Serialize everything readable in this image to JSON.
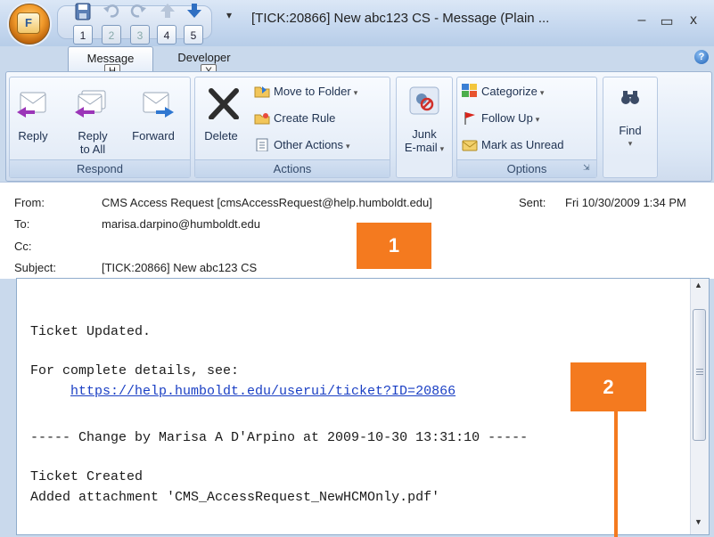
{
  "window": {
    "title": "[TICK:20866] New abc123 CS - Message (Plain ...",
    "office_button_letter": "F",
    "qat_keytips": [
      "1",
      "2",
      "3",
      "4",
      "5"
    ],
    "minimize": "–",
    "maximize": "▭",
    "close": "x"
  },
  "tabs": [
    {
      "label": "Message",
      "keytip": "H",
      "active": true
    },
    {
      "label": "Developer",
      "keytip": "Y",
      "active": false
    }
  ],
  "ribbon": {
    "respond": {
      "label": "Respond",
      "reply": "Reply",
      "reply_all_1": "Reply",
      "reply_all_2": "to All",
      "forward": "Forward"
    },
    "actions": {
      "label": "Actions",
      "delete": "Delete",
      "move_to_folder": "Move to Folder",
      "create_rule": "Create Rule",
      "other_actions": "Other Actions"
    },
    "junk": {
      "label_1": "Junk",
      "label_2": "E-mail"
    },
    "options": {
      "label": "Options",
      "categorize": "Categorize",
      "follow_up": "Follow Up",
      "mark_as_unread": "Mark as Unread"
    },
    "find": {
      "label": "Find"
    }
  },
  "header": {
    "from_label": "From:",
    "from_value": "CMS Access Request [cmsAccessRequest@help.humboldt.edu]",
    "sent_label": "Sent:",
    "sent_value": "Fri 10/30/2009 1:34 PM",
    "to_label": "To:",
    "to_value": "marisa.darpino@humboldt.edu",
    "cc_label": "Cc:",
    "cc_value": "",
    "subject_label": "Subject:",
    "subject_value": "[TICK:20866] New abc123 CS"
  },
  "body": {
    "line1": "Ticket Updated.",
    "line2": "For complete details, see:",
    "link": "https://help.humboldt.edu/userui/ticket?ID=20866",
    "line3": "----- Change by Marisa A D'Arpino at 2009-10-30 13:31:10 -----",
    "line4": "Ticket Created",
    "line5": "Added attachment 'CMS_AccessRequest_NewHCMOnly.pdf'"
  },
  "callouts": [
    "1",
    "2"
  ],
  "colors": {
    "callout": "#f47a1f",
    "link": "#1a3fc4"
  }
}
